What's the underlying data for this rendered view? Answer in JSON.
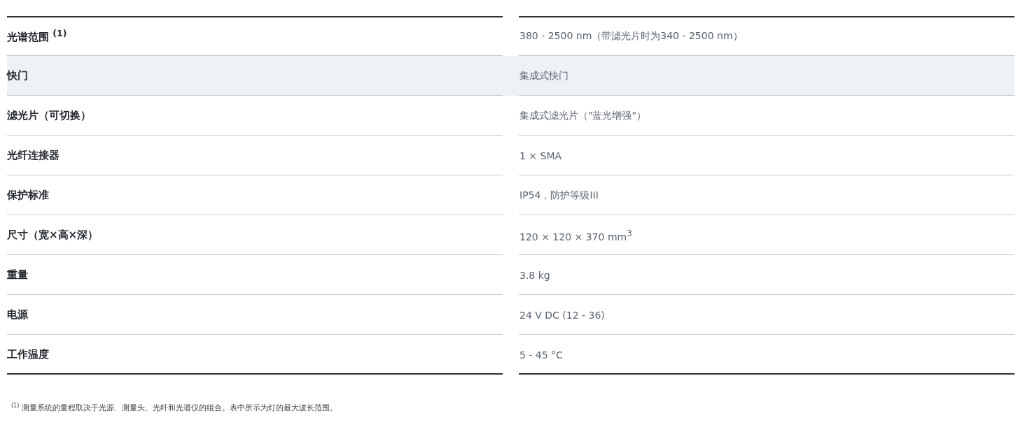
{
  "rows": [
    {
      "label": "光谱范围 $^{(1)}$",
      "value": "380 - 2500 nm（带滤光片时为340 - 2500 nm）",
      "highlighted": false
    },
    {
      "label": "快门",
      "value": "集成式快门",
      "highlighted": true
    },
    {
      "label": "滤光片（可切换）",
      "value": "集成式滤光片（\"蓝光增强\"）",
      "highlighted": false
    },
    {
      "label": "光纤连接器",
      "value": "1 × SMA",
      "highlighted": false
    },
    {
      "label": "保护标准",
      "value": "IP54，防护等级III",
      "highlighted": false
    },
    {
      "label": "尺寸（宽×高×深）",
      "value": "120 × 120 × 370 mm$^{3}$",
      "highlighted": false
    },
    {
      "label": "重量",
      "value": "3.8 kg",
      "highlighted": false
    },
    {
      "label": "电源",
      "value": "24 V DC (12 - 36)",
      "highlighted": false
    },
    {
      "label": "工作温度",
      "value": "5 - 45 °C",
      "highlighted": false
    }
  ],
  "footnote": {
    "mark": "(1)",
    "text": "测量系统的量程取决于光源、测量头、光纤和光谱仪的组合。表中所示为灯的最大波长范围。"
  }
}
